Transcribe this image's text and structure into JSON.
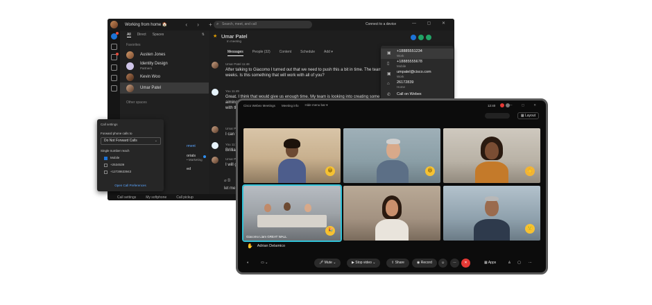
{
  "app": {
    "status": "Working from home 🏠",
    "nav": "‹ › +",
    "search_placeholder": "Search, meet, and call",
    "connect": "Connect to a device",
    "window_buttons": "— ▢ ✕",
    "list_tabs": [
      "All",
      "Direct",
      "Spaces"
    ],
    "favorites_label": "Favorites",
    "contacts": [
      {
        "name": "Austen Jones",
        "sub": ""
      },
      {
        "name": "Identity Design",
        "sub": "Partners"
      },
      {
        "name": "Kevin Woo",
        "sub": ""
      },
      {
        "name": "Umar Patel",
        "sub": ""
      }
    ],
    "other_spaces_label": "Other spaces",
    "partial_items": [
      "rment",
      "orials",
      "• Marketing",
      "ed"
    ],
    "chat": {
      "name": "Umar Patel",
      "status": "In meeting",
      "tabs": [
        "Messages",
        "People (32)",
        "Content",
        "Schedule",
        "Add ▾"
      ],
      "messages": [
        {
          "who": "Umar Patel  11:48",
          "text": "After talking to Giacomo I turned out that we need to push this a bit in time. The team weeks. Is this something that will work with all of you?"
        },
        {
          "who": "You  11:49",
          "text": "Great. I think that would give us enough time. My team is looking into creating some n aiming to have this done by Wednesday. I still need to talk to the branding folks so we with th"
        },
        {
          "who": "Umar Patel  11:",
          "text": "I can t"
        },
        {
          "who": "You  11:",
          "text": "Brillia"
        },
        {
          "who": "Umar Pat",
          "text": "I will g"
        }
      ],
      "composer_text": "let me",
      "tools": "⌀  B"
    },
    "statusbar": [
      "Call settings",
      "My softphone",
      "Call pickup"
    ],
    "call_menu": [
      {
        "value": "+18885551234",
        "type": "Work",
        "icon": "briefcase-icon"
      },
      {
        "value": "+18885555678",
        "type": "Mobile",
        "icon": "mobile-icon"
      },
      {
        "value": "umpatel@cisco.com",
        "type": "Work",
        "icon": "briefcase-icon"
      },
      {
        "value": "26172839",
        "type": "Home",
        "icon": "home-icon"
      },
      {
        "value": "Call on Webex",
        "type": "",
        "icon": "phone-icon"
      }
    ],
    "settings": {
      "title": "Call settings",
      "forward_label": "Forward phone calls to",
      "forward_value": "Do Not Forward Calls",
      "single_number_label": "Single number reach",
      "numbers": [
        {
          "label": "Mobile",
          "checked": true
        },
        {
          "label": "+2534539",
          "checked": false
        },
        {
          "label": "+12728633943",
          "checked": false
        }
      ],
      "link": "Open Call Preferences"
    }
  },
  "meeting": {
    "title": "Cisco Webex Meetings",
    "meeting_info": "Meeting info",
    "more": "Hide menu bar ▾",
    "time": "12:40",
    "window_buttons": "— ▢ ✕",
    "layout": "Layout",
    "tiles": [
      {
        "name": "",
        "emoji": "😀"
      },
      {
        "name": "",
        "emoji": "😆"
      },
      {
        "name": "",
        "emoji": "👋"
      },
      {
        "name": "Giacomo Liam   GREAT WALL",
        "emoji": "🎉"
      },
      {
        "name": "",
        "emoji": ""
      },
      {
        "name": "",
        "emoji": "🙂"
      }
    ],
    "speaker": "Adrian Delamico",
    "controls": {
      "mute": "Mute",
      "stop_video": "Stop video",
      "share": "Share",
      "record": "Record",
      "apps": "Apps"
    }
  }
}
